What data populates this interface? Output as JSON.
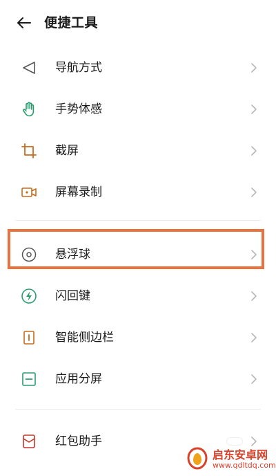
{
  "header": {
    "title": "便捷工具",
    "back_icon": "arrow-left-icon"
  },
  "items": [
    {
      "label": "导航方式",
      "icon": "navigation-triangle-icon"
    },
    {
      "label": "手势体感",
      "icon": "hand-gesture-icon"
    },
    {
      "label": "截屏",
      "icon": "crop-icon"
    },
    {
      "label": "屏幕录制",
      "icon": "video-record-icon"
    },
    {
      "label": "悬浮球",
      "icon": "floating-ball-icon"
    },
    {
      "label": "闪回键",
      "icon": "flash-icon"
    },
    {
      "label": "智能侧边栏",
      "icon": "sidebar-icon"
    },
    {
      "label": "应用分屏",
      "icon": "split-screen-icon"
    },
    {
      "label": "红包助手",
      "icon": "envelope-icon"
    }
  ],
  "watermark": {
    "line1": "启东安卓网",
    "line2": "www.qdltdq.com"
  },
  "colors": {
    "accent_green": "#2a9d6f",
    "accent_orange": "#c96a1b",
    "highlight_border": "#e8733f",
    "icon_gray": "#555555",
    "chevron": "#b8b8b8"
  }
}
